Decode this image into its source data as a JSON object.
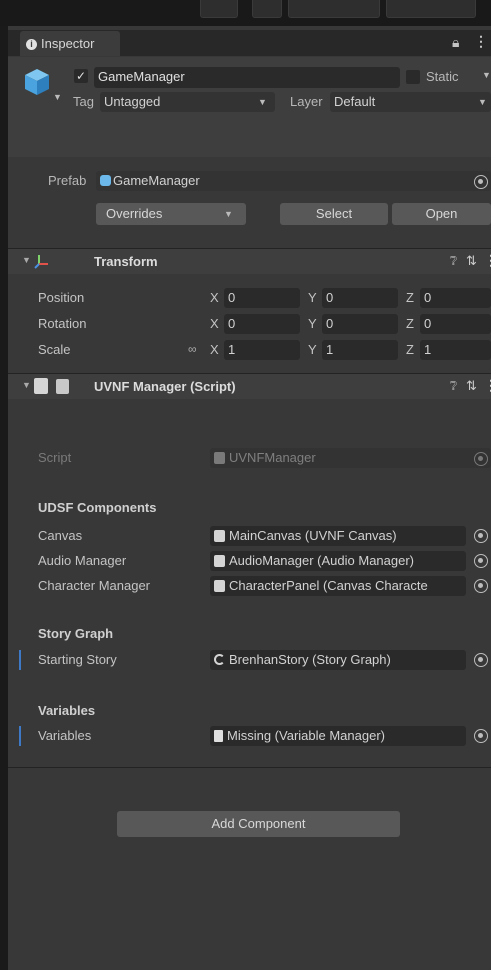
{
  "inspector": {
    "tab_label": "Inspector",
    "game_object": {
      "active": true,
      "name": "GameManager",
      "static_label": "Static",
      "tag_label": "Tag",
      "tag_value": "Untagged",
      "layer_label": "Layer",
      "layer_value": "Default"
    },
    "prefab": {
      "label": "Prefab",
      "value": "GameManager",
      "overrides_label": "Overrides",
      "select_label": "Select",
      "open_label": "Open"
    },
    "transform": {
      "title": "Transform",
      "position_label": "Position",
      "rotation_label": "Rotation",
      "scale_label": "Scale",
      "x_axis": "X",
      "y_axis": "Y",
      "z_axis": "Z",
      "position": {
        "x": "0",
        "y": "0",
        "z": "0"
      },
      "rotation": {
        "x": "0",
        "y": "0",
        "z": "0"
      },
      "scale": {
        "x": "1",
        "y": "1",
        "z": "1"
      }
    },
    "script_component": {
      "title": "UVNF Manager (Script)",
      "script_label": "Script",
      "script_value": "UVNFManager",
      "udsf_header": "UDSF Components",
      "canvas_label": "Canvas",
      "canvas_value": "MainCanvas (UVNF Canvas)",
      "audio_label": "Audio Manager",
      "audio_value": "AudioManager (Audio Manager)",
      "character_label": "Character Manager",
      "character_value": "CharacterPanel (Canvas Characte",
      "story_header": "Story Graph",
      "story_label": "Starting Story",
      "story_value": "BrenhanStory (Story Graph)",
      "variables_header": "Variables",
      "variables_label": "Variables",
      "variables_value": "Missing (Variable Manager)"
    },
    "add_component_label": "Add Component"
  }
}
